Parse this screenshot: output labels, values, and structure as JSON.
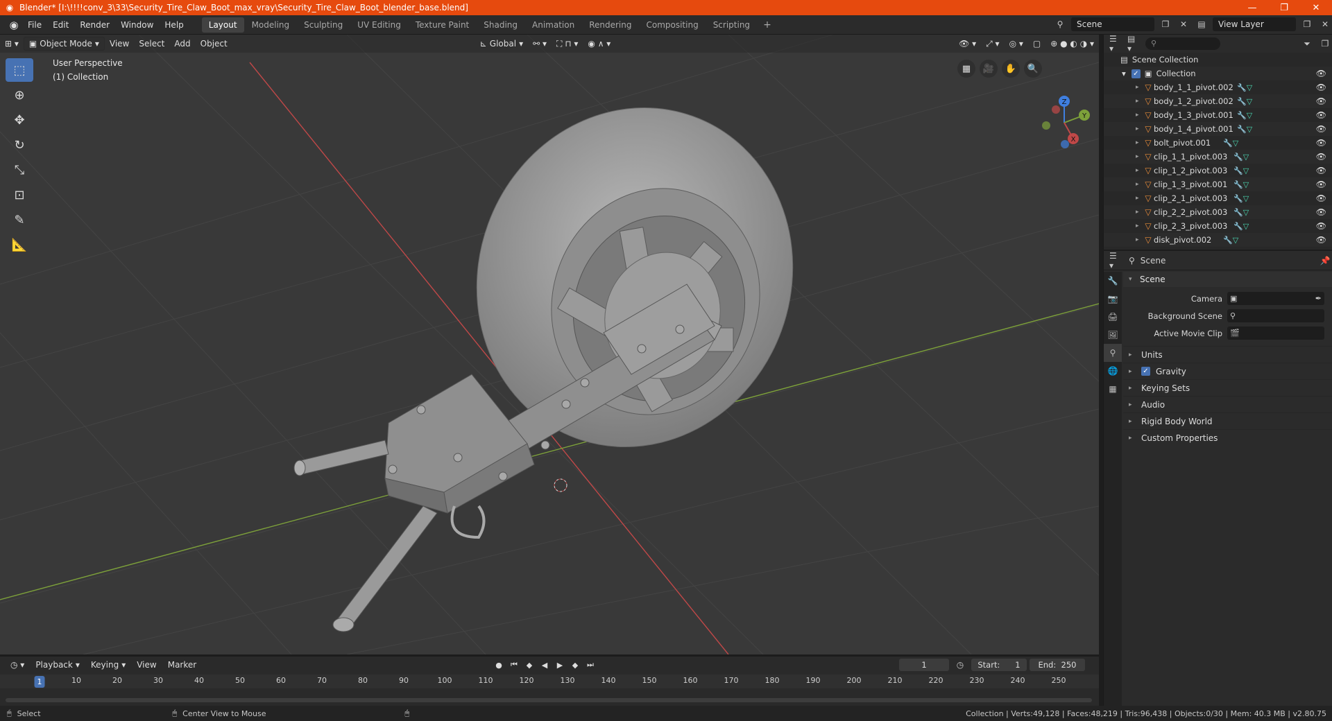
{
  "window": {
    "title": "Blender* [I:\\!!!!conv_3\\33\\Security_Tire_Claw_Boot_max_vray\\Security_Tire_Claw_Boot_blender_base.blend]",
    "controls": [
      "—",
      "❐",
      "✕"
    ]
  },
  "menu": [
    "File",
    "Edit",
    "Render",
    "Window",
    "Help"
  ],
  "workspaces": [
    "Layout",
    "Modeling",
    "Sculpting",
    "UV Editing",
    "Texture Paint",
    "Shading",
    "Animation",
    "Rendering",
    "Compositing",
    "Scripting"
  ],
  "active_workspace": "Layout",
  "scene_field": "Scene",
  "view_layer_field": "View Layer",
  "viewport": {
    "mode": "Object Mode",
    "menus": [
      "View",
      "Select",
      "Add",
      "Object"
    ],
    "transform_orientation": "Global",
    "perspective_label": "User Perspective",
    "collection_label": "(1) Collection",
    "gizmo_axes": {
      "z": "Z",
      "y": "Y",
      "x": "X"
    },
    "colors": {
      "x_axis": "#c04848",
      "y_axis": "#7da13a",
      "z_axis": "#3f7fe0",
      "grid": "#404040",
      "bg": "#393939"
    }
  },
  "outliner": {
    "root": "Scene Collection",
    "collection": "Collection",
    "items": [
      "body_1_1_pivot.002",
      "body_1_2_pivot.002",
      "body_1_3_pivot.001",
      "body_1_4_pivot.001",
      "bolt_pivot.001",
      "clip_1_1_pivot.003",
      "clip_1_2_pivot.003",
      "clip_1_3_pivot.001",
      "clip_2_1_pivot.003",
      "clip_2_2_pivot.003",
      "clip_2_3_pivot.003",
      "disk_pivot.002"
    ]
  },
  "properties": {
    "context": "Scene",
    "panel": "Scene",
    "fields": [
      {
        "label": "Camera"
      },
      {
        "label": "Background Scene"
      },
      {
        "label": "Active Movie Clip"
      }
    ],
    "subpanels": [
      "Units",
      "Gravity",
      "Keying Sets",
      "Audio",
      "Rigid Body World",
      "Custom Properties"
    ],
    "gravity_checked": true
  },
  "timeline": {
    "menus": [
      "Playback",
      "Keying",
      "View",
      "Marker"
    ],
    "current_frame": "1",
    "start_label": "Start:",
    "start": "1",
    "end_label": "End:",
    "end": "250",
    "ticks": [
      "10",
      "20",
      "30",
      "40",
      "50",
      "60",
      "70",
      "80",
      "90",
      "100",
      "110",
      "120",
      "130",
      "140",
      "150",
      "160",
      "170",
      "180",
      "190",
      "200",
      "210",
      "220",
      "230",
      "240",
      "250"
    ]
  },
  "statusbar": {
    "left_action": "Select",
    "mid_action": "Center View to Mouse",
    "stats": "Collection | Verts:49,128 | Faces:48,219 | Tris:96,438 | Objects:0/30 | Mem: 40.3 MB | v2.80.75"
  }
}
